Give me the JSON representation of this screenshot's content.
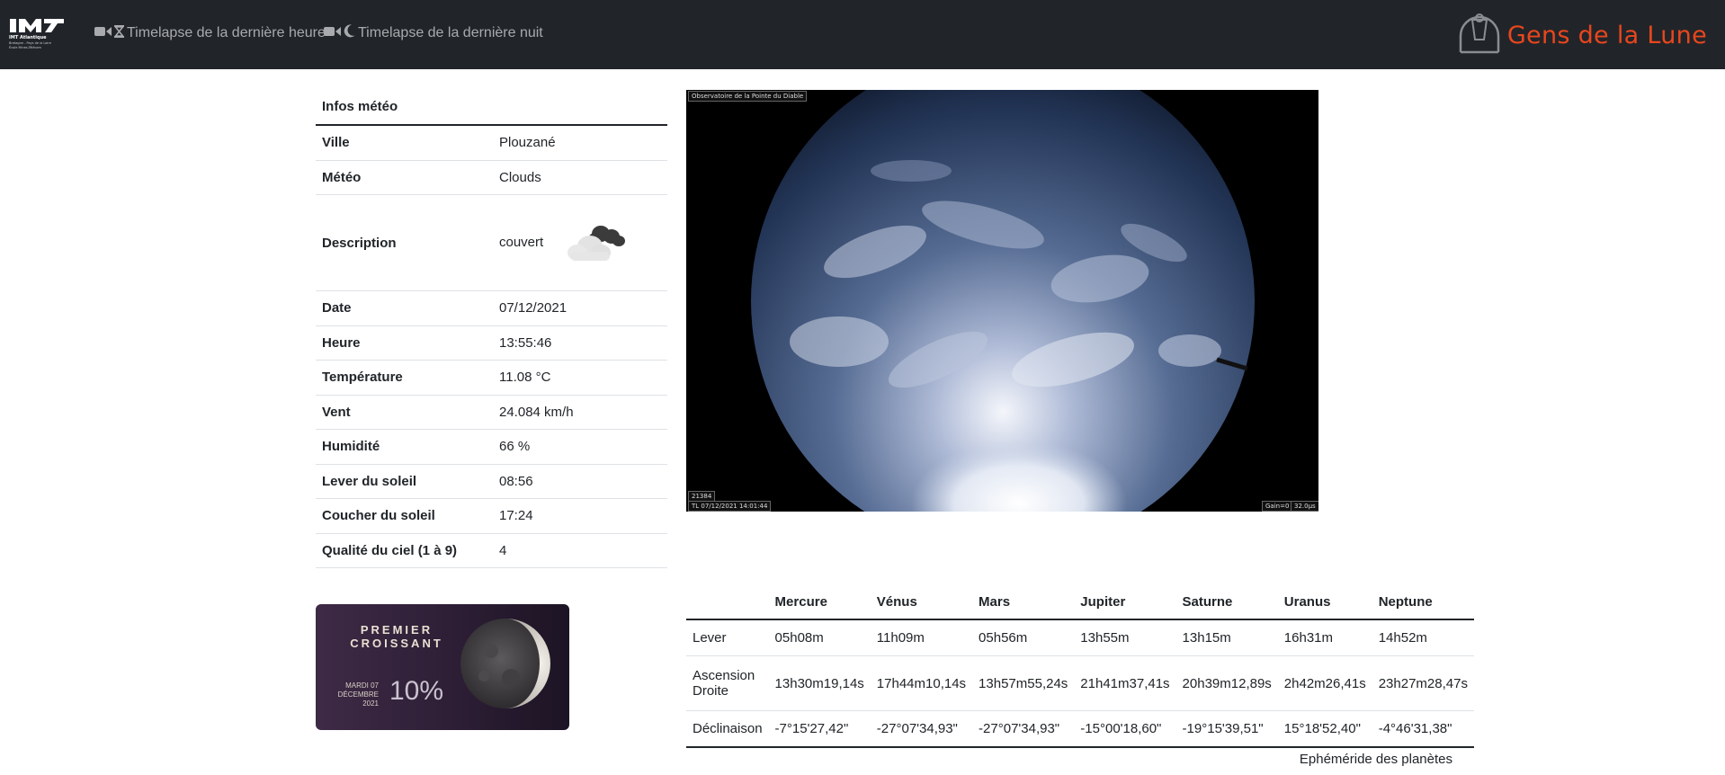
{
  "navbar": {
    "logo_alt": "IMT Atlantique",
    "logo_lines": [
      "IMT Atlantique",
      "Bretagne - Pays de la Loire",
      "École Mines-Télécom"
    ],
    "links": [
      {
        "label": "Timelapse de la dernière heure",
        "icons": [
          "video-camera-icon",
          "hourglass-icon"
        ]
      },
      {
        "label": "Timelapse de la dernière nuit",
        "icons": [
          "video-camera-icon",
          "moon-icon"
        ]
      }
    ],
    "brand": "Gens de la Lune",
    "colors": {
      "background": "#212529",
      "link": "#a8aaad",
      "brand": "#e8461e"
    }
  },
  "weather": {
    "title": "Infos météo",
    "rows": [
      {
        "key": "Ville",
        "value": "Plouzané"
      },
      {
        "key": "Météo",
        "value": "Clouds"
      },
      {
        "key": "Description",
        "value": "couvert",
        "icon": "overcast-cloud-icon"
      },
      {
        "key": "Date",
        "value": "07/12/2021"
      },
      {
        "key": "Heure",
        "value": "13:55:46"
      },
      {
        "key": "Température",
        "value": "11.08 °C"
      },
      {
        "key": "Vent",
        "value": "24.084 km/h"
      },
      {
        "key": "Humidité",
        "value": "66 %"
      },
      {
        "key": "Lever du soleil",
        "value": "08:56"
      },
      {
        "key": "Coucher du soleil",
        "value": "17:24"
      },
      {
        "key": "Qualité du ciel (1 à 9)",
        "value": "4"
      }
    ]
  },
  "skycam": {
    "title_overlay": "Observatoire de la Pointe du Diable",
    "timestamp_overlay": "TL 07/12/2021 14:01:44",
    "small_tag": "21384",
    "gain_overlay": "Gain=0",
    "exposure_overlay": "32.0µs"
  },
  "moon": {
    "phase_line1": "PREMIER",
    "phase_line2": "CROISSANT",
    "date_line1": "MARDI 07",
    "date_line2": "DÉCEMBRE 2021",
    "illumination": "10%"
  },
  "planets": {
    "columns": [
      "Mercure",
      "Vénus",
      "Mars",
      "Jupiter",
      "Saturne",
      "Uranus",
      "Neptune"
    ],
    "rows": [
      {
        "label": "Lever",
        "values": [
          "05h08m",
          "11h09m",
          "05h56m",
          "13h55m",
          "13h15m",
          "16h31m",
          "14h52m"
        ]
      },
      {
        "label": "Ascension Droite",
        "values": [
          "13h30m19,14s",
          "17h44m10,14s",
          "13h57m55,24s",
          "21h41m37,41s",
          "20h39m12,89s",
          "2h42m26,41s",
          "23h27m28,47s"
        ]
      },
      {
        "label": "Déclinaison",
        "values": [
          "-7°15'27,42\"",
          "-27°07'34,93\"",
          "-27°07'34,93\"",
          "-15°00'18,60\"",
          "-19°15'39,51\"",
          "15°18'52,40\"",
          "-4°46'31,38\""
        ]
      }
    ],
    "caption": "Ephéméride des planètes"
  }
}
